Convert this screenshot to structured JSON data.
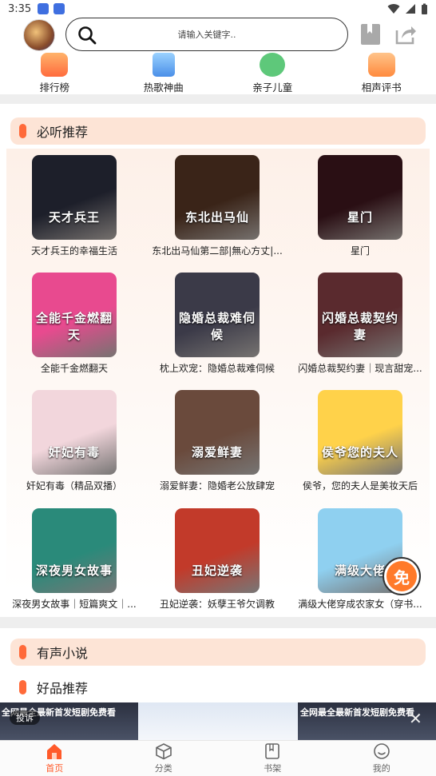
{
  "status_bar": {
    "time": "3:35"
  },
  "search": {
    "placeholder": "请输入关键字.."
  },
  "categories": [
    {
      "label": "排行榜",
      "icon": "ranking-icon"
    },
    {
      "label": "热歌神曲",
      "icon": "hot-songs-icon"
    },
    {
      "label": "亲子儿童",
      "icon": "kids-icon"
    },
    {
      "label": "相声评书",
      "icon": "crosstalk-icon"
    }
  ],
  "must_listen": {
    "title": "必听推荐",
    "books": [
      {
        "title": "天才兵王的幸福生活",
        "cover_text": "天才兵王",
        "color": "#1d1f2a"
      },
      {
        "title": "东北出马仙第二部|無心方丈|...",
        "cover_text": "东北出马仙",
        "color": "#3a2418"
      },
      {
        "title": "星门",
        "cover_text": "星门",
        "color": "#2a0f14"
      },
      {
        "title": "全能千金燃翻天",
        "cover_text": "全能千金燃翻天",
        "color": "#e84a8f"
      },
      {
        "title": "枕上欢宠：隐婚总裁难伺候",
        "cover_text": "隐婚总裁难伺候",
        "color": "#3b3a48"
      },
      {
        "title": "闪婚总裁契约妻｜现言甜宠...",
        "cover_text": "闪婚总裁契约妻",
        "color": "#5a2a2e"
      },
      {
        "title": "奸妃有毒（精品双播）",
        "cover_text": "奸妃有毒",
        "color": "#f2d6dc"
      },
      {
        "title": "溺爱鲜妻：隐婚老公放肆宠",
        "cover_text": "溺爱鲜妻",
        "color": "#6a4a3c"
      },
      {
        "title": "侯爷，您的夫人是美妆天后",
        "cover_text": "侯爷您的夫人",
        "color": "#ffd24a"
      },
      {
        "title": "深夜男女故事｜短篇爽文｜...",
        "cover_text": "深夜男女故事",
        "color": "#2a8a7a"
      },
      {
        "title": "丑妃逆袭：妖孽王爷欠调教",
        "cover_text": "丑妃逆袭",
        "color": "#c23a2a"
      },
      {
        "title": "满级大佬穿成农家女（穿书...",
        "cover_text": "满级大佬",
        "color": "#8fd0f0"
      }
    ]
  },
  "audio_novel": {
    "title": "有声小说"
  },
  "good_picks": {
    "title": "好品推荐"
  },
  "ad": {
    "left_text": "全网最全最新首发短剧免费看",
    "right_text": "全网最全最新首发短剧免费看",
    "report_label": "投诉",
    "close_symbol": "✕"
  },
  "free_badge": "免",
  "bottom_nav": [
    {
      "label": "首页",
      "icon": "home-icon",
      "active": true
    },
    {
      "label": "分类",
      "icon": "category-icon",
      "active": false
    },
    {
      "label": "书架",
      "icon": "bookshelf-icon",
      "active": false
    },
    {
      "label": "我的",
      "icon": "profile-icon",
      "active": false
    }
  ],
  "colors": {
    "accent": "#ff5a2a",
    "section_bg": "#fde4d6"
  }
}
